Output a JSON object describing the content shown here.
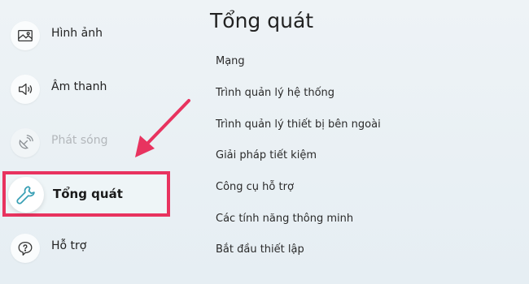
{
  "sidebar": {
    "items": [
      {
        "label": "Hình ảnh",
        "icon": "picture-icon",
        "state": "normal"
      },
      {
        "label": "Âm thanh",
        "icon": "speaker-icon",
        "state": "normal"
      },
      {
        "label": "Phát sóng",
        "icon": "satellite-icon",
        "state": "disabled"
      },
      {
        "label": "Tổng quát",
        "icon": "wrench-icon",
        "state": "selected"
      },
      {
        "label": "Hỗ trợ",
        "icon": "help-chat-icon",
        "state": "normal"
      }
    ]
  },
  "main": {
    "title": "Tổng quát",
    "options": [
      "Mạng",
      "Trình quản lý hệ thống",
      "Trình quản lý thiết bị bên ngoài",
      "Giải pháp tiết kiệm",
      "Công cụ hỗ trợ",
      "Các tính năng thông minh",
      "Bắt đầu thiết lập"
    ]
  },
  "colors": {
    "highlight": "#e8335f",
    "selected_icon": "#3aa0b5",
    "text": "#222222",
    "disabled_text": "#b3b7bb"
  }
}
